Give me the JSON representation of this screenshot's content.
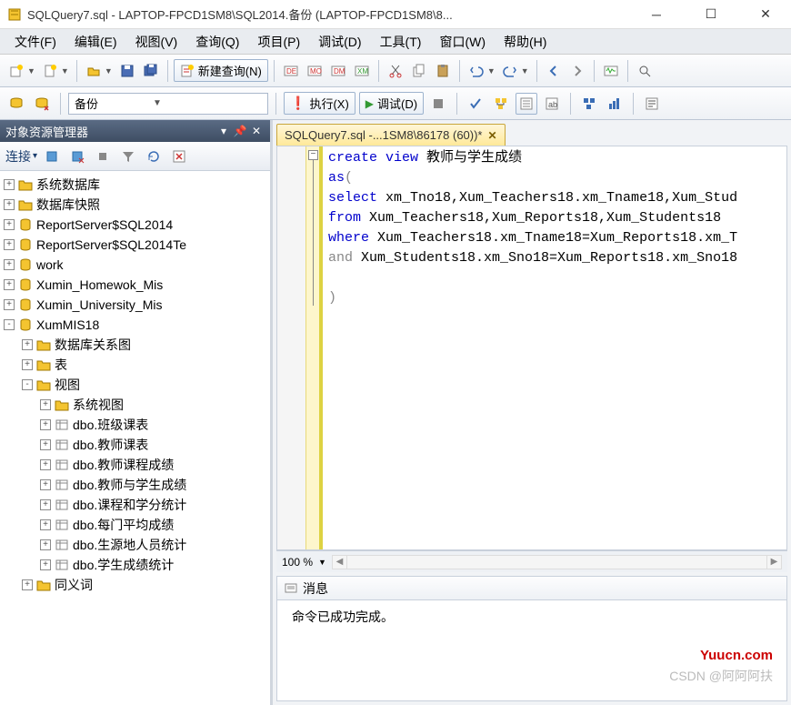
{
  "window": {
    "title": "SQLQuery7.sql - LAPTOP-FPCD1SM8\\SQL2014.备份 (LAPTOP-FPCD1SM8\\8..."
  },
  "menu": {
    "items": [
      "文件(F)",
      "编辑(E)",
      "视图(V)",
      "查询(Q)",
      "项目(P)",
      "调试(D)",
      "工具(T)",
      "窗口(W)",
      "帮助(H)"
    ]
  },
  "toolbar1": {
    "new_query": "新建查询(N)"
  },
  "toolbar2": {
    "db": "备份",
    "execute": "执行(X)",
    "debug": "调试(D)"
  },
  "sidebar": {
    "title": "对象资源管理器",
    "connect": "连接",
    "tree": [
      {
        "pad": 0,
        "exp": "+",
        "icon": "folder",
        "label": "系统数据库"
      },
      {
        "pad": 0,
        "exp": "+",
        "icon": "folder",
        "label": "数据库快照"
      },
      {
        "pad": 0,
        "exp": "+",
        "icon": "db",
        "label": "ReportServer$SQL2014"
      },
      {
        "pad": 0,
        "exp": "+",
        "icon": "db",
        "label": "ReportServer$SQL2014Te"
      },
      {
        "pad": 0,
        "exp": "+",
        "icon": "db",
        "label": "work"
      },
      {
        "pad": 0,
        "exp": "+",
        "icon": "db",
        "label": "Xumin_Homewok_Mis"
      },
      {
        "pad": 0,
        "exp": "+",
        "icon": "db",
        "label": "Xumin_University_Mis"
      },
      {
        "pad": 0,
        "exp": "-",
        "icon": "db",
        "label": "XumMIS18"
      },
      {
        "pad": 1,
        "exp": "+",
        "icon": "folder",
        "label": "数据库关系图"
      },
      {
        "pad": 1,
        "exp": "+",
        "icon": "folder",
        "label": "表"
      },
      {
        "pad": 1,
        "exp": "-",
        "icon": "folder",
        "label": "视图"
      },
      {
        "pad": 2,
        "exp": "+",
        "icon": "folder",
        "label": "系统视图"
      },
      {
        "pad": 2,
        "exp": "+",
        "icon": "view",
        "label": "dbo.班级课表"
      },
      {
        "pad": 2,
        "exp": "+",
        "icon": "view",
        "label": "dbo.教师课表"
      },
      {
        "pad": 2,
        "exp": "+",
        "icon": "view",
        "label": "dbo.教师课程成绩"
      },
      {
        "pad": 2,
        "exp": "+",
        "icon": "view",
        "label": "dbo.教师与学生成绩"
      },
      {
        "pad": 2,
        "exp": "+",
        "icon": "view",
        "label": "dbo.课程和学分统计"
      },
      {
        "pad": 2,
        "exp": "+",
        "icon": "view",
        "label": "dbo.每门平均成绩"
      },
      {
        "pad": 2,
        "exp": "+",
        "icon": "view",
        "label": "dbo.生源地人员统计"
      },
      {
        "pad": 2,
        "exp": "+",
        "icon": "view",
        "label": "dbo.学生成绩统计"
      },
      {
        "pad": 1,
        "exp": "+",
        "icon": "folder",
        "label": "同义词"
      }
    ]
  },
  "editor": {
    "tab_label": "SQLQuery7.sql -...1SM8\\86178 (60))*",
    "code": {
      "l1_kw1": "create",
      "l1_kw2": "view",
      "l1_txt": " 教师与学生成绩",
      "l2_kw": "as",
      "l2_txt": "(",
      "l3_kw": "select",
      "l3_txt": " xm_Tno18,Xum_Teachers18.xm_Tname18,Xum_Stud",
      "l4_kw": "from",
      "l4_txt": " Xum_Teachers18,Xum_Reports18,Xum_Students18",
      "l5_kw": "where",
      "l5_txt": " Xum_Teachers18.xm_Tname18=Xum_Reports18.xm_T",
      "l6_kw": "and",
      "l6_txt": " Xum_Students18.xm_Sno18=Xum_Reports18.xm_Sno18",
      "l7_txt": ")"
    },
    "zoom": "100 %"
  },
  "messages": {
    "tab": "消息",
    "body": "命令已成功完成。"
  },
  "watermark": {
    "w1": "Yuucn.com",
    "w2": "CSDN @阿阿阿扶"
  }
}
